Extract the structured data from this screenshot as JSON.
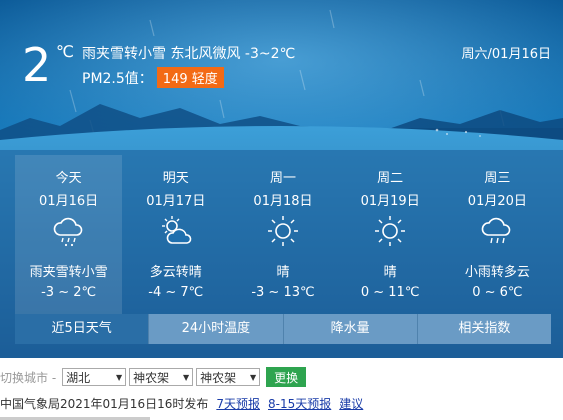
{
  "current": {
    "temp": "2",
    "unit": "℃",
    "description": "雨夹雪转小雪  东北风微风  -3~2℃",
    "date": "周六/01月16日",
    "pm_label": "PM2.5值：",
    "pm_value": "149 轻度"
  },
  "forecast": [
    {
      "name": "今天",
      "date": "01月16日",
      "icon": "rain-snow-icon",
      "condition": "雨夹雪转小雪",
      "temp": "-3 ~ 2℃"
    },
    {
      "name": "明天",
      "date": "01月17日",
      "icon": "partly-cloudy-icon",
      "condition": "多云转晴",
      "temp": "-4 ~ 7℃"
    },
    {
      "name": "周一",
      "date": "01月18日",
      "icon": "sun-icon",
      "condition": "晴",
      "temp": "-3 ~ 13℃"
    },
    {
      "name": "周二",
      "date": "01月19日",
      "icon": "sun-icon",
      "condition": "晴",
      "temp": "0 ~ 11℃"
    },
    {
      "name": "周三",
      "date": "01月20日",
      "icon": "light-rain-icon",
      "condition": "小雨转多云",
      "temp": "0 ~ 6℃"
    }
  ],
  "tabs": [
    "近5日天气",
    "24小时温度",
    "降水量",
    "相关指数"
  ],
  "city_switch": {
    "label": "切换城市 -",
    "province": "湖北",
    "city": "神农架",
    "district": "神农架",
    "go": "更换"
  },
  "publish": {
    "text": "中国气象局2021年01月16日16时发布",
    "links": [
      "7天预报",
      "8-15天预报",
      "建议"
    ]
  },
  "colors": {
    "pm_badge": "#f36a15",
    "go_button": "#2ea44f",
    "link": "#1a3ca8"
  }
}
